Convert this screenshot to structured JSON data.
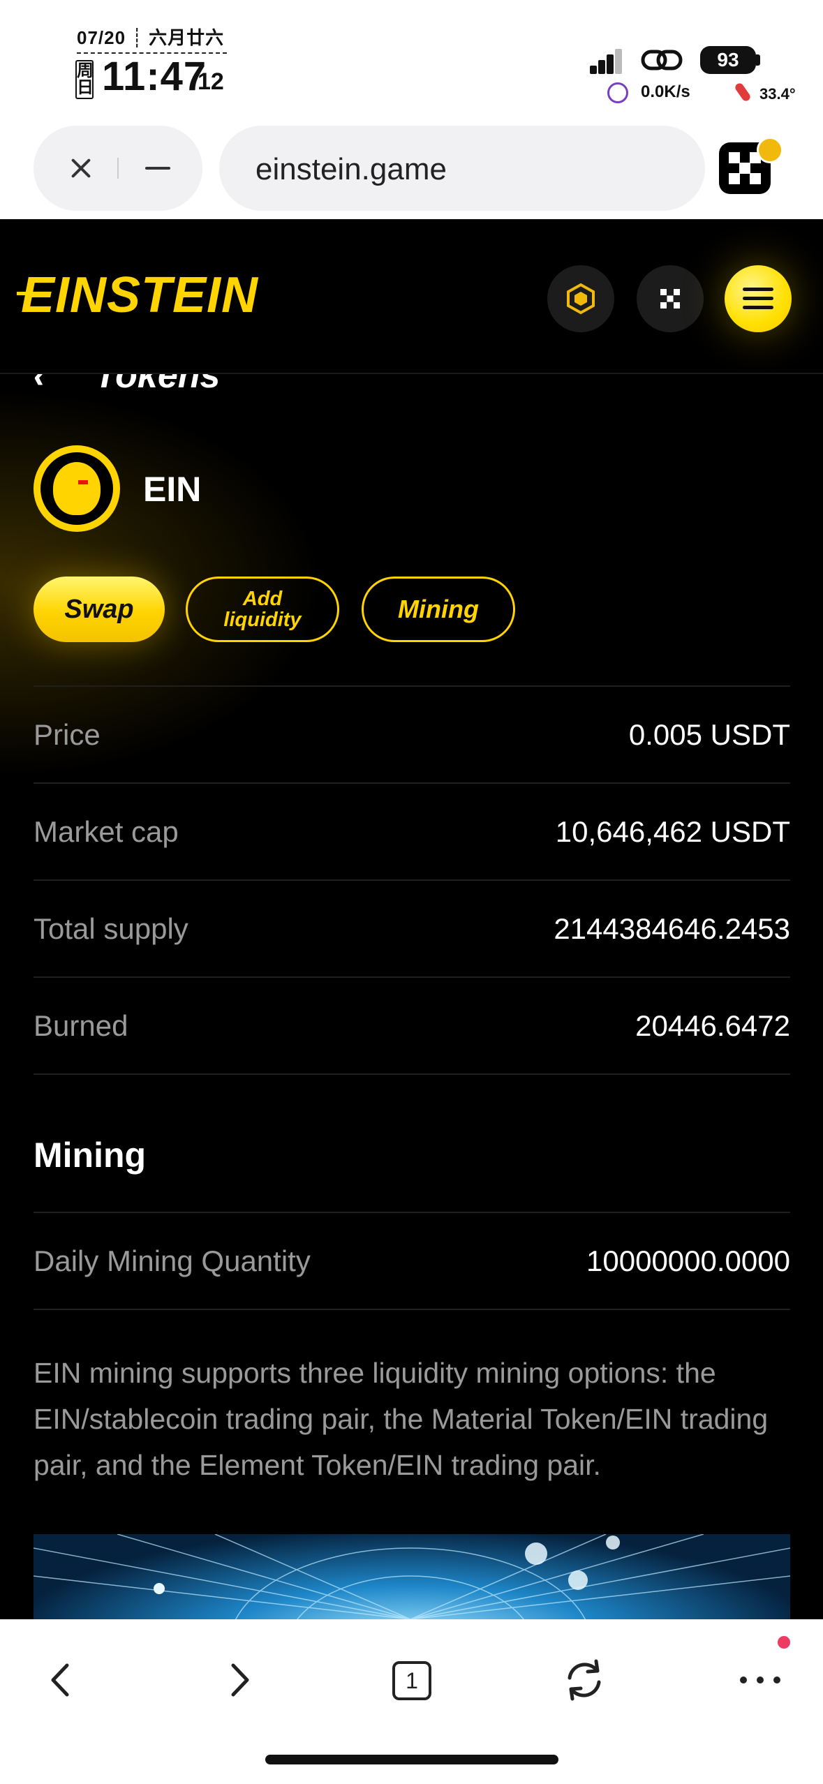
{
  "status_bar": {
    "date": "07/20 ┊ 六月廿六",
    "weekday": "周日",
    "time": "11:47",
    "seconds": "12",
    "battery": "93",
    "net_speed": "0.0K/s",
    "temperature": "33.4°"
  },
  "browser": {
    "url": "einstein.game",
    "close_icon": "close-icon",
    "minimize_icon": "minimize-icon"
  },
  "site": {
    "logo_text": "EINSTEIN",
    "header_icons": [
      "bnb-chain-icon",
      "okx-icon",
      "menu-icon"
    ]
  },
  "page": {
    "title": "Tokens",
    "token_name": "EIN",
    "actions": {
      "swap": "Swap",
      "add_liquidity": "Add liquidity",
      "mining": "Mining"
    },
    "stats": [
      {
        "label": "Price",
        "value": "0.005 USDT"
      },
      {
        "label": "Market cap",
        "value": "10,646,462 USDT"
      },
      {
        "label": "Total supply",
        "value": "2144384646.2453"
      },
      {
        "label": "Burned",
        "value": "20446.6472"
      }
    ],
    "mining_section": {
      "title": "Mining",
      "rows": [
        {
          "label": "Daily Mining Quantity",
          "value": "10000000.0000"
        }
      ],
      "description": "EIN mining supports three liquidity mining options: the EIN/stablecoin trading pair, the Material Token/EIN trading pair, and the Element Token/EIN trading pair."
    }
  },
  "bottom_nav": {
    "tab_count": "1",
    "items": [
      "back-icon",
      "forward-icon",
      "tabs-icon",
      "reload-icon",
      "more-icon"
    ]
  },
  "colors": {
    "accent": "#ffd400",
    "background": "#000000",
    "muted_text": "#9a9a9a"
  }
}
